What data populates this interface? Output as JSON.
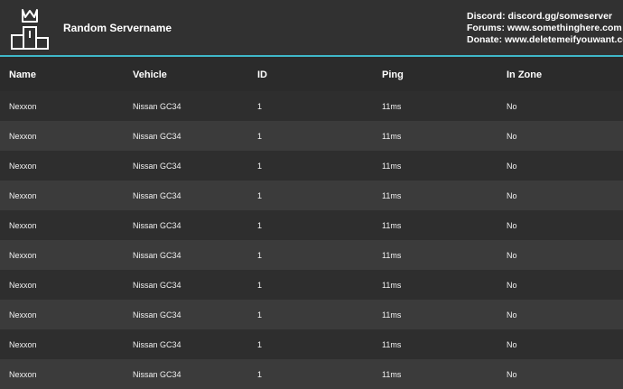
{
  "header": {
    "server_name": "Random Servername",
    "info_lines": [
      "Discord: discord.gg/someserver",
      "Forums: www.somethinghere.com",
      "Donate: www.deletemeifyouwant.com"
    ],
    "logo_icon": "podium-crown-icon",
    "accent_color": "#3fb8c9"
  },
  "table": {
    "columns": [
      "Name",
      "Vehicle",
      "ID",
      "Ping",
      "In Zone"
    ],
    "rows": [
      [
        "Nexxon",
        "Nissan GC34",
        "1",
        "11ms",
        "No"
      ],
      [
        "Nexxon",
        "Nissan GC34",
        "1",
        "11ms",
        "No"
      ],
      [
        "Nexxon",
        "Nissan GC34",
        "1",
        "11ms",
        "No"
      ],
      [
        "Nexxon",
        "Nissan GC34",
        "1",
        "11ms",
        "No"
      ],
      [
        "Nexxon",
        "Nissan GC34",
        "1",
        "11ms",
        "No"
      ],
      [
        "Nexxon",
        "Nissan GC34",
        "1",
        "11ms",
        "No"
      ],
      [
        "Nexxon",
        "Nissan GC34",
        "1",
        "11ms",
        "No"
      ],
      [
        "Nexxon",
        "Nissan GC34",
        "1",
        "11ms",
        "No"
      ],
      [
        "Nexxon",
        "Nissan GC34",
        "1",
        "11ms",
        "No"
      ],
      [
        "Nexxon",
        "Nissan GC34",
        "1",
        "11ms",
        "No"
      ]
    ]
  }
}
